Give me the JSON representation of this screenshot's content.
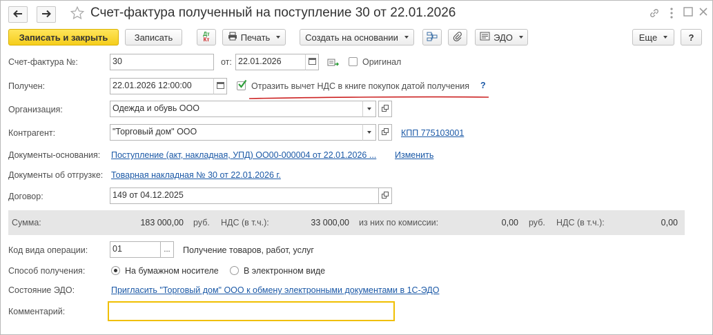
{
  "window": {
    "title": "Счет-фактура полученный на поступление 30 от 22.01.2026",
    "back_icon": "arrow-left-icon",
    "forward_icon": "arrow-right-icon",
    "favorite_icon": "star-icon",
    "header_icons": [
      "link-icon",
      "more-vertical-icon",
      "maximize-icon",
      "close-icon"
    ]
  },
  "toolbar": {
    "save_close": "Записать и закрыть",
    "save": "Записать",
    "dt_kt_top": "Дт",
    "dt_kt_bottom": "Кт",
    "print": "Печать",
    "create_based": "Создать на основании",
    "edo": "ЭДО",
    "more": "Еще",
    "help": "?"
  },
  "form": {
    "invoice_label": "Счет-фактура №:",
    "invoice_number": "30",
    "from_label": "от:",
    "invoice_date": "22.01.2026",
    "original_label": "Оригинал",
    "original_checked": false,
    "received_label": "Получен:",
    "received_datetime": "22.01.2026 12:00:00",
    "vat_deduction_label": "Отразить вычет НДС в книге покупок датой получения",
    "vat_deduction_checked": true,
    "vat_help": "?",
    "organization_label": "Организация:",
    "organization": "Одежда и обувь ООО",
    "counterparty_label": "Контрагент:",
    "counterparty": "\"Торговый дом\" ООО",
    "kpp_link": "КПП 775103001",
    "base_docs_label": "Документы-основания:",
    "base_docs_link": "Поступление (акт, накладная, УПД) ОО00-000004 от 22.01.2026 ...",
    "change_link": "Изменить",
    "shipment_docs_label": "Документы об отгрузке:",
    "shipment_docs_link": "Товарная накладная № 30 от 22.01.2026 г.",
    "contract_label": "Договор:",
    "contract": "149 от 04.12.2025"
  },
  "totals": {
    "sum_label": "Сумма:",
    "sum_value": "183 000,00",
    "currency1": "руб.",
    "vat_label1": "НДС (в т.ч.):",
    "vat_value1": "33 000,00",
    "commission_label": "из них по комиссии:",
    "commission_value": "0,00",
    "currency2": "руб.",
    "vat_label2": "НДС (в т.ч.):",
    "vat_value2": "0,00"
  },
  "operation": {
    "code_label": "Код вида операции:",
    "code_value": "01",
    "code_select": "...",
    "code_description": "Получение товаров, работ, услуг",
    "method_label": "Способ получения:",
    "method_paper": "На бумажном носителе",
    "method_electronic": "В электронном виде",
    "method_selected": "paper",
    "edo_state_label": "Состояние ЭДО:",
    "edo_invite_link": "Пригласить \"Торговый дом\" ООО к обмену электронными документами в 1С-ЭДО",
    "comment_label": "Комментарий:",
    "comment_value": ""
  },
  "colors": {
    "primary_button": "#f5cd1c",
    "link": "#1a58a6",
    "check_green": "#2e9e3a",
    "annotation_underline": "#cc2222",
    "comment_focus_border": "#f0bf00"
  }
}
